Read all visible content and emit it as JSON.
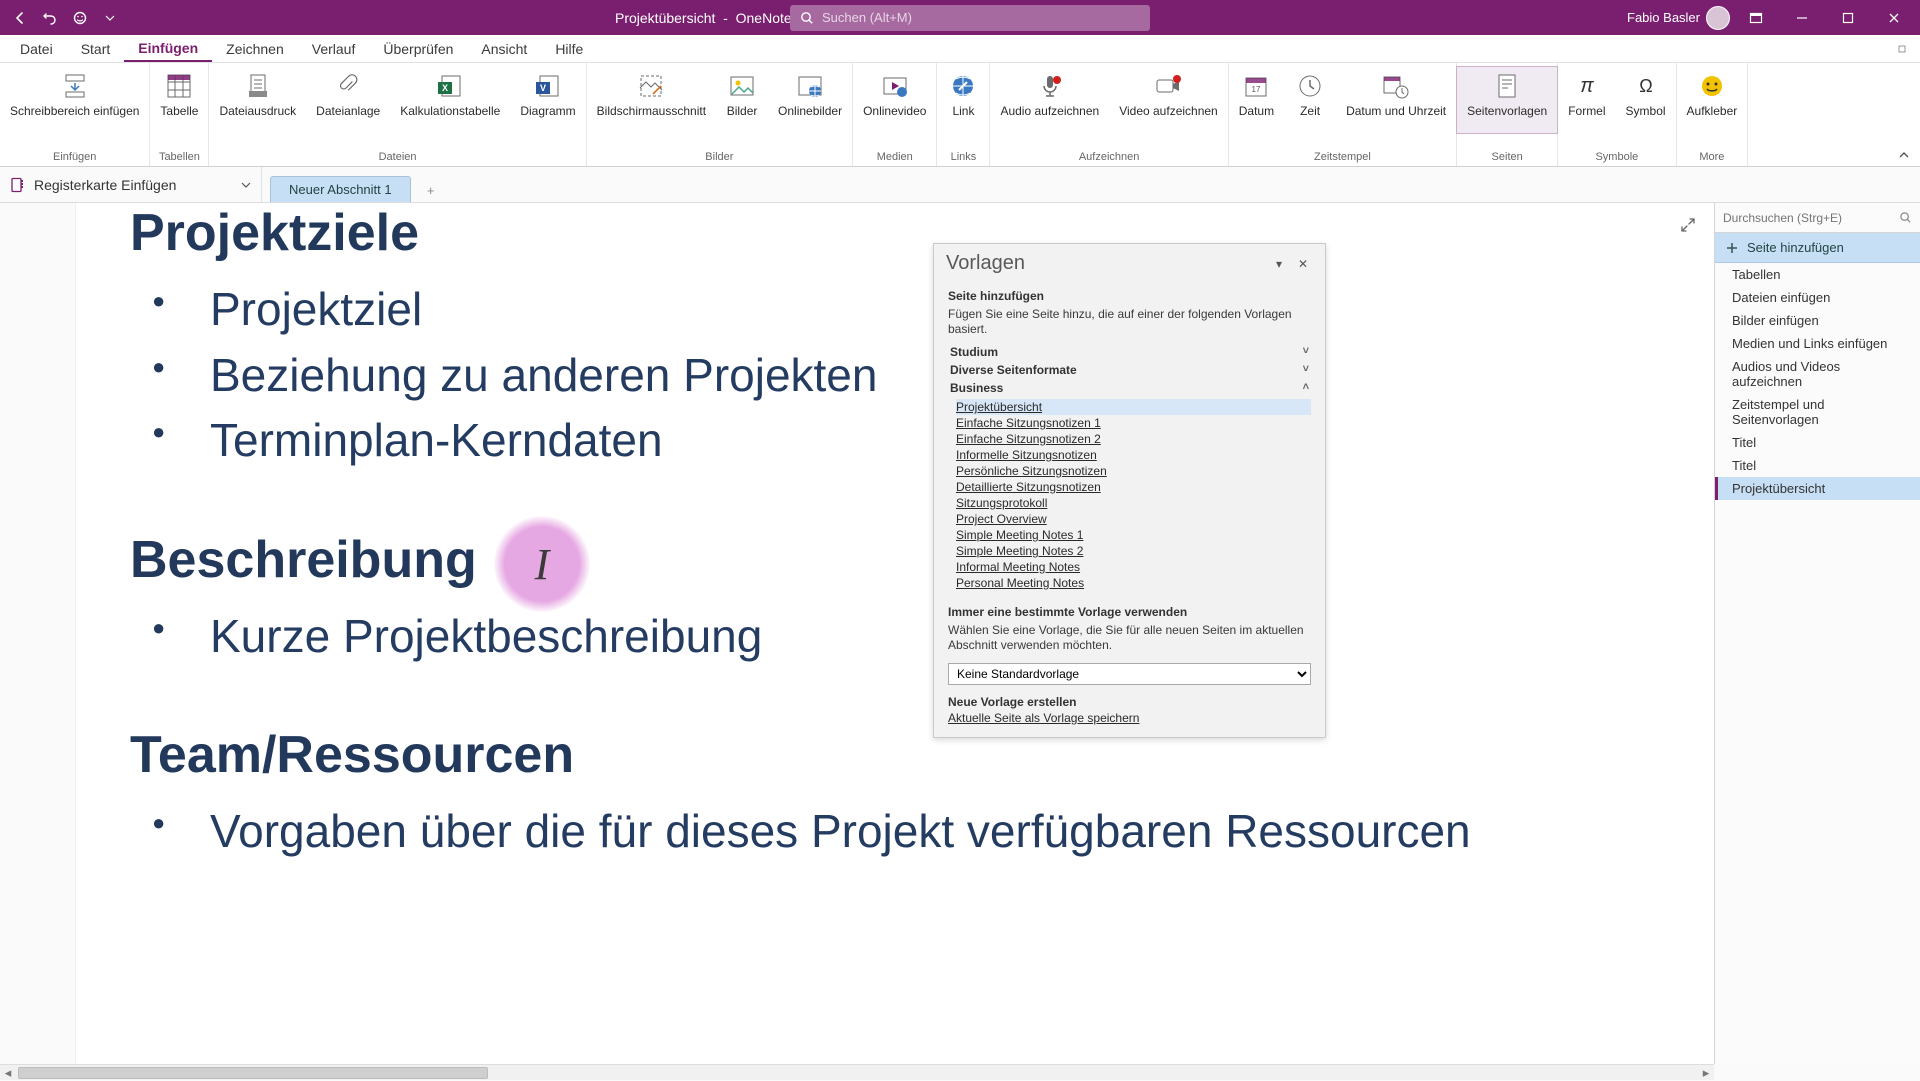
{
  "app": {
    "doc": "Projektübersicht",
    "name": "OneNote",
    "user": "Fabio Basler"
  },
  "search_placeholder": "Suchen (Alt+M)",
  "menus": [
    "Datei",
    "Start",
    "Einfügen",
    "Zeichnen",
    "Verlauf",
    "Überprüfen",
    "Ansicht",
    "Hilfe"
  ],
  "menus_active_index": 2,
  "ribbon": {
    "groups": [
      {
        "label": "Einfügen",
        "items": [
          {
            "label": "Schreibbereich einfügen"
          }
        ]
      },
      {
        "label": "Tabellen",
        "items": [
          {
            "label": "Tabelle"
          }
        ]
      },
      {
        "label": "Dateien",
        "items": [
          {
            "label": "Dateiausdruck"
          },
          {
            "label": "Dateianlage"
          },
          {
            "label": "Kalkulationstabelle"
          },
          {
            "label": "Diagramm"
          }
        ]
      },
      {
        "label": "Bilder",
        "items": [
          {
            "label": "Bildschirmausschnitt"
          },
          {
            "label": "Bilder"
          },
          {
            "label": "Onlinebilder"
          }
        ]
      },
      {
        "label": "Medien",
        "items": [
          {
            "label": "Onlinevideo"
          }
        ]
      },
      {
        "label": "Links",
        "items": [
          {
            "label": "Link"
          }
        ]
      },
      {
        "label": "Aufzeichnen",
        "items": [
          {
            "label": "Audio aufzeichnen"
          },
          {
            "label": "Video aufzeichnen"
          }
        ]
      },
      {
        "label": "Zeitstempel",
        "items": [
          {
            "label": "Datum"
          },
          {
            "label": "Zeit"
          },
          {
            "label": "Datum und Uhrzeit"
          }
        ]
      },
      {
        "label": "Seiten",
        "items": [
          {
            "label": "Seitenvorlagen",
            "active": true
          }
        ]
      },
      {
        "label": "Symbole",
        "items": [
          {
            "label": "Formel"
          },
          {
            "label": "Symbol"
          }
        ]
      },
      {
        "label": "More",
        "items": [
          {
            "label": "Aufkleber"
          }
        ]
      }
    ]
  },
  "notebook_picker": "Registerkarte Einfügen",
  "section_tabs": [
    {
      "label": "Neuer Abschnitt 1"
    }
  ],
  "page": {
    "h1": "Projektziele",
    "b1": [
      "Projektziel",
      "Beziehung zu anderen Projekten",
      "Terminplan-Kerndaten"
    ],
    "h2": "Beschreibung",
    "b2": [
      "Kurze Projektbeschreibung"
    ],
    "h3": "Team/Ressourcen",
    "b3": [
      "Vorgaben über die für dieses Projekt verfügbaren Ressourcen"
    ]
  },
  "templates": {
    "title": "Vorlagen",
    "add_title": "Seite hinzufügen",
    "add_desc": "Fügen Sie eine Seite hinzu, die auf einer der folgenden Vorlagen basiert.",
    "cats": [
      {
        "name": "Studium",
        "open": false
      },
      {
        "name": "Diverse Seitenformate",
        "open": false
      },
      {
        "name": "Business",
        "open": true,
        "links": [
          "Projektübersicht",
          "Einfache Sitzungsnotizen 1",
          "Einfache Sitzungsnotizen 2",
          "Informelle Sitzungsnotizen",
          "Persönliche Sitzungsnotizen",
          "Detaillierte Sitzungsnotizen",
          "Sitzungsprotokoll",
          "Project Overview",
          "Simple Meeting Notes 1",
          "Simple Meeting Notes 2",
          "Informal Meeting Notes",
          "Personal Meeting Notes"
        ],
        "selected_index": 0
      }
    ],
    "always_title": "Immer eine bestimmte Vorlage verwenden",
    "always_desc": "Wählen Sie eine Vorlage, die Sie für alle neuen Seiten im aktuellen Abschnitt verwenden möchten.",
    "select_value": "Keine Standardvorlage",
    "create_title": "Neue Vorlage erstellen",
    "create_link": "Aktuelle Seite als Vorlage speichern"
  },
  "page_panel": {
    "search_placeholder": "Durchsuchen (Strg+E)",
    "add_page": "Seite hinzufügen",
    "items": [
      "Tabellen",
      "Dateien einfügen",
      "Bilder einfügen",
      "Medien und Links einfügen",
      "Audios und Videos aufzeichnen",
      "Zeitstempel und Seitenvorlagen",
      "Titel",
      "Titel",
      "Projektübersicht"
    ],
    "selected_index": 8
  }
}
